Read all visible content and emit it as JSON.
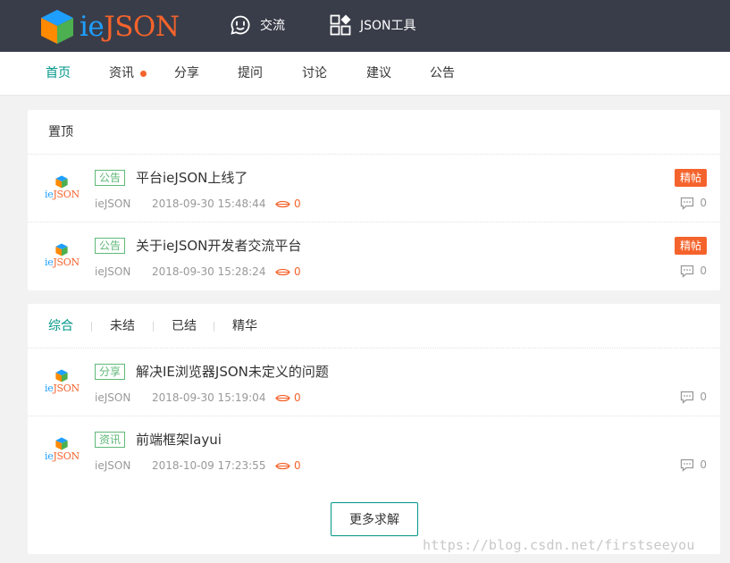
{
  "brand": {
    "prefix": "ie",
    "suffix": "JSON",
    "colors": {
      "ie": "#1e9fff",
      "json": "#f5632c"
    }
  },
  "header": {
    "nav": [
      {
        "label": "交流",
        "icon": "chat-bubble-icon"
      },
      {
        "label": "JSON工具",
        "icon": "apps-grid-icon"
      }
    ]
  },
  "subnav": {
    "items": [
      {
        "label": "首页",
        "active": true
      },
      {
        "label": "资讯",
        "has_dot": true
      },
      {
        "label": "分享"
      },
      {
        "label": "提问"
      },
      {
        "label": "讨论"
      },
      {
        "label": "建议"
      },
      {
        "label": "公告"
      }
    ]
  },
  "pinned": {
    "title": "置顶",
    "posts": [
      {
        "tag": "公告",
        "title": "平台ieJSON上线了",
        "author": "ieJSON",
        "time": "2018-09-30 15:48:44",
        "views": "0",
        "badge": "精帖",
        "replies": "0"
      },
      {
        "tag": "公告",
        "title": "关于ieJSON开发者交流平台",
        "author": "ieJSON",
        "time": "2018-09-30 15:28:24",
        "views": "0",
        "badge": "精帖",
        "replies": "0"
      }
    ]
  },
  "list": {
    "filters": [
      {
        "label": "综合",
        "active": true
      },
      {
        "label": "未结"
      },
      {
        "label": "已结"
      },
      {
        "label": "精华"
      }
    ],
    "posts": [
      {
        "tag": "分享",
        "title": "解决IE浏览器JSON未定义的问题",
        "author": "ieJSON",
        "time": "2018-09-30 15:19:04",
        "views": "0",
        "replies": "0"
      },
      {
        "tag": "资讯",
        "title": "前端框架layui",
        "author": "ieJSON",
        "time": "2018-10-09 17:23:55",
        "views": "0",
        "replies": "0"
      }
    ],
    "more_button": "更多求解"
  },
  "watermark": "https://blog.csdn.net/firstseeyou",
  "theme": {
    "header_bg": "#393d49",
    "accent": "#009688",
    "tag_green": "#5fb878",
    "orange": "#f5632c"
  }
}
